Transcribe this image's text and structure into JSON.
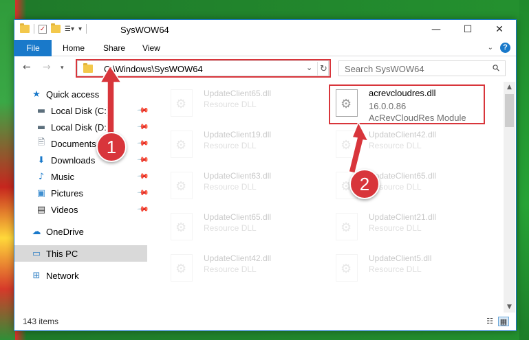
{
  "window": {
    "title": "SysWOW64"
  },
  "ribbon": {
    "tabs": [
      "File",
      "Home",
      "Share",
      "View"
    ]
  },
  "address": {
    "path": "C:\\Windows\\SysWOW64"
  },
  "search": {
    "placeholder": "Search SysWOW64"
  },
  "nav": {
    "items": [
      {
        "label": "Quick access",
        "icon": "star-icon",
        "pinned": false
      },
      {
        "label": "Local Disk (C:)",
        "icon": "drive-icon",
        "pinned": true
      },
      {
        "label": "Local Disk (D:)",
        "icon": "drive-icon",
        "pinned": true
      },
      {
        "label": "Documents",
        "icon": "documents-icon",
        "pinned": true
      },
      {
        "label": "Downloads",
        "icon": "download-icon",
        "pinned": true
      },
      {
        "label": "Music",
        "icon": "music-icon",
        "pinned": true
      },
      {
        "label": "Pictures",
        "icon": "pictures-icon",
        "pinned": true
      },
      {
        "label": "Videos",
        "icon": "videos-icon",
        "pinned": true
      },
      {
        "label": "OneDrive",
        "icon": "cloud-icon",
        "pinned": false
      },
      {
        "label": "This PC",
        "icon": "computer-icon",
        "pinned": false
      },
      {
        "label": "Network",
        "icon": "network-icon",
        "pinned": false
      }
    ],
    "selected": "This PC"
  },
  "files": {
    "left": [
      {
        "name": "UpdateClient65.dll",
        "type": "Resource DLL"
      },
      {
        "name": "UpdateClient19.dll",
        "type": "Resource DLL"
      },
      {
        "name": "UpdateClient63.dll",
        "type": "Resource DLL"
      },
      {
        "name": "UpdateClient65.dll",
        "type": "Resource DLL"
      },
      {
        "name": "UpdateClient42.dll",
        "type": "Resource DLL"
      }
    ],
    "right": [
      {
        "name": "UpdateClient42.dll",
        "type": "Resource DLL"
      },
      {
        "name": "UpdateClient65.dll",
        "type": "Resource DLL"
      },
      {
        "name": "UpdateClient21.dll",
        "type": "Resource DLL"
      },
      {
        "name": "UpdateClient5.dll",
        "type": "Resource DLL"
      }
    ],
    "target": {
      "name": "acrevcloudres.dll",
      "version": "16.0.0.86",
      "description": "AcRevCloudRes Module"
    }
  },
  "status": {
    "item_count": "143 items"
  },
  "annotations": {
    "step1": "1",
    "step2": "2",
    "accent_color": "#d8353b"
  },
  "colors": {
    "file_tab": "#1979ca",
    "highlight": "#d8353b"
  }
}
